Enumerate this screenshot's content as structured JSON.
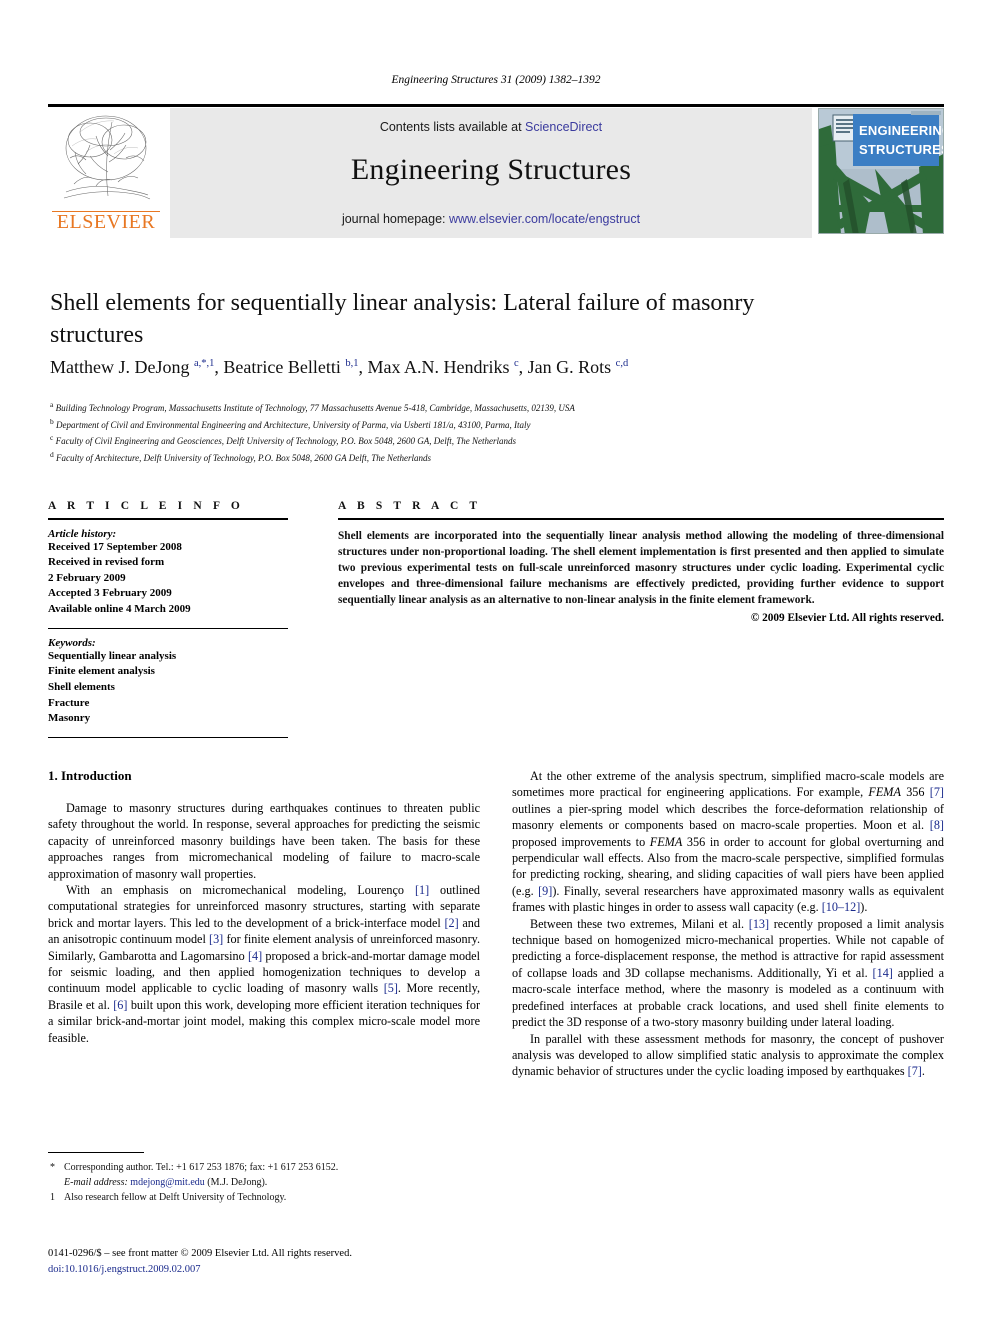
{
  "running_head": "Engineering Structures 31 (2009) 1382–1392",
  "masthead": {
    "contents_prefix": "Contents lists available at ",
    "contents_link": "ScienceDirect",
    "journal_name": "Engineering Structures",
    "homepage_prefix": "journal homepage: ",
    "homepage_link": "www.elsevier.com/locate/engstruct",
    "publisher_logo_text": "ELSEVIER",
    "cover_title_line1": "ENGINEERING",
    "cover_title_line2": "STRUCTURES",
    "link_color": "#3b3b9e",
    "elsevier_orange": "#e87722",
    "cover_blue": "#3b7ec4"
  },
  "article": {
    "title": "Shell elements for sequentially linear analysis: Lateral failure of masonry structures",
    "authors_html": "Matthew J. DeJong <sup>a,*,1</sup>, Beatrice Belletti <sup>b,1</sup>, Max A.N. Hendriks <sup>c</sup>, Jan G. Rots <sup>c,d</sup>",
    "affiliations": [
      {
        "mark": "a",
        "text": "Building Technology Program, Massachusetts Institute of Technology, 77 Massachusetts Avenue 5-418, Cambridge, Massachusetts, 02139, USA"
      },
      {
        "mark": "b",
        "text": "Department of Civil and Environmental Engineering and Architecture, University of Parma, via Usberti 181/a, 43100, Parma, Italy"
      },
      {
        "mark": "c",
        "text": "Faculty of Civil Engineering and Geosciences, Delft University of Technology, P.O. Box 5048, 2600 GA, Delft, The Netherlands"
      },
      {
        "mark": "d",
        "text": "Faculty of Architecture, Delft University of Technology, P.O. Box 5048, 2600 GA Delft, The Netherlands"
      }
    ]
  },
  "article_info": {
    "heading": "A R T I C L E    I N F O",
    "history_label": "Article history:",
    "history": [
      "Received 17 September 2008",
      "Received in revised form",
      "2 February 2009",
      "Accepted 3 February 2009",
      "Available online 4 March 2009"
    ],
    "keywords_label": "Keywords:",
    "keywords": [
      "Sequentially linear analysis",
      "Finite element analysis",
      "Shell elements",
      "Fracture",
      "Masonry"
    ]
  },
  "abstract": {
    "heading": "A B S T R A C T",
    "text": "Shell elements are incorporated into the sequentially linear analysis method allowing the modeling of three-dimensional structures under non-proportional loading. The shell element implementation is first presented and then applied to simulate two previous experimental tests on full-scale unreinforced masonry structures under cyclic loading. Experimental cyclic envelopes and three-dimensional failure mechanisms are effectively predicted, providing further evidence to support sequentially linear analysis as an alternative to non-linear analysis in the finite element framework.",
    "copyright": "© 2009 Elsevier Ltd. All rights reserved."
  },
  "body": {
    "section_heading": "1. Introduction",
    "left_paragraphs": [
      "Damage to masonry structures during earthquakes continues to threaten public safety throughout the world. In response, several approaches for predicting the seismic capacity of unreinforced masonry buildings have been taken. The basis for these approaches ranges from micromechanical modeling of failure to macro-scale approximation of masonry wall properties.",
      "With an emphasis on micromechanical modeling, Lourenço [1] outlined computational strategies for unreinforced masonry structures, starting with separate brick and mortar layers. This led to the development of a brick-interface model [2] and an anisotropic continuum model [3] for finite element analysis of unreinforced masonry. Similarly, Gambarotta and Lagomarsino [4] proposed a brick-and-mortar damage model for seismic loading, and then applied homogenization techniques to develop a continuum model applicable to cyclic loading of masonry walls [5]. More recently, Brasile et al. [6] built upon this work, developing more efficient iteration techniques for a similar brick-and-mortar joint model, making this complex micro-scale model more feasible."
    ],
    "right_paragraphs": [
      "At the other extreme of the analysis spectrum, simplified macro-scale models are sometimes more practical for engineering applications. For example, FEMA 356 [7] outlines a pier-spring model which describes the force-deformation relationship of masonry elements or components based on macro-scale properties. Moon et al. [8] proposed improvements to FEMA 356 in order to account for global overturning and perpendicular wall effects. Also from the macro-scale perspective, simplified formulas for predicting rocking, shearing, and sliding capacities of wall piers have been applied (e.g. [9]). Finally, several researchers have approximated masonry walls as equivalent frames with plastic hinges in order to assess wall capacity (e.g. [10–12]).",
      "Between these two extremes, Milani et al. [13] recently proposed a limit analysis technique based on homogenized micro-mechanical properties. While not capable of predicting a force-displacement response, the method is attractive for rapid assessment of collapse loads and 3D collapse mechanisms. Additionally, Yi et al. [14] applied a macro-scale interface method, where the masonry is modeled as a continuum with predefined interfaces at probable crack locations, and used shell finite elements to predict the 3D response of a two-story masonry building under lateral loading.",
      "In parallel with these assessment methods for masonry, the concept of pushover analysis was developed to allow simplified static analysis to approximate the complex dynamic behavior of structures under the cyclic loading imposed by earthquakes [7]."
    ]
  },
  "footnotes": {
    "corresponding_mark": "*",
    "corresponding_text": "Corresponding author. Tel.: +1 617 253 1876; fax: +1 617 253 6152.",
    "email_label": "E-mail address:",
    "email": "mdejong@mit.edu",
    "email_suffix": "(M.J. DeJong).",
    "note_mark": "1",
    "note_text": "Also research fellow at Delft University of Technology."
  },
  "imprint": {
    "line1": "0141-0296/$ – see front matter © 2009 Elsevier Ltd. All rights reserved.",
    "doi_label": "doi:",
    "doi": "10.1016/j.engstruct.2009.02.007"
  }
}
